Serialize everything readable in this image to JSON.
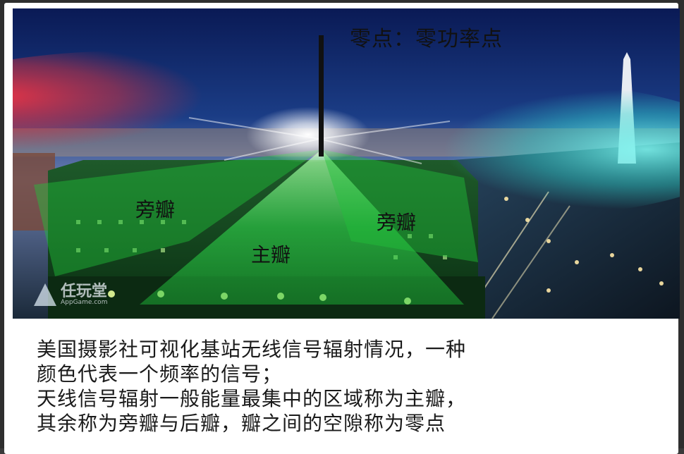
{
  "image": {
    "zero_point_label": "零点：零功率点",
    "side_lobe_left": "旁瓣",
    "side_lobe_right": "旁瓣",
    "main_lobe": "主瓣",
    "watermark": {
      "main": "任玩堂",
      "sub": "AppGame.com"
    }
  },
  "caption": {
    "lines": [
      "美国摄影社可视化基站无线信号辐射情况，一种",
      "颜色代表一个频率的信号；",
      "天线信号辐射一般能量最集中的区域称为主瓣，",
      "其余称为旁瓣与后瓣，瓣之间的空隙称为零点"
    ]
  },
  "colors": {
    "main_lobe": "#1fbf3a",
    "left_beam": "#e0303a",
    "right_beam": "#32d6d0",
    "sky_top": "#0a1a55",
    "sky_bottom": "#3a6aa8"
  }
}
